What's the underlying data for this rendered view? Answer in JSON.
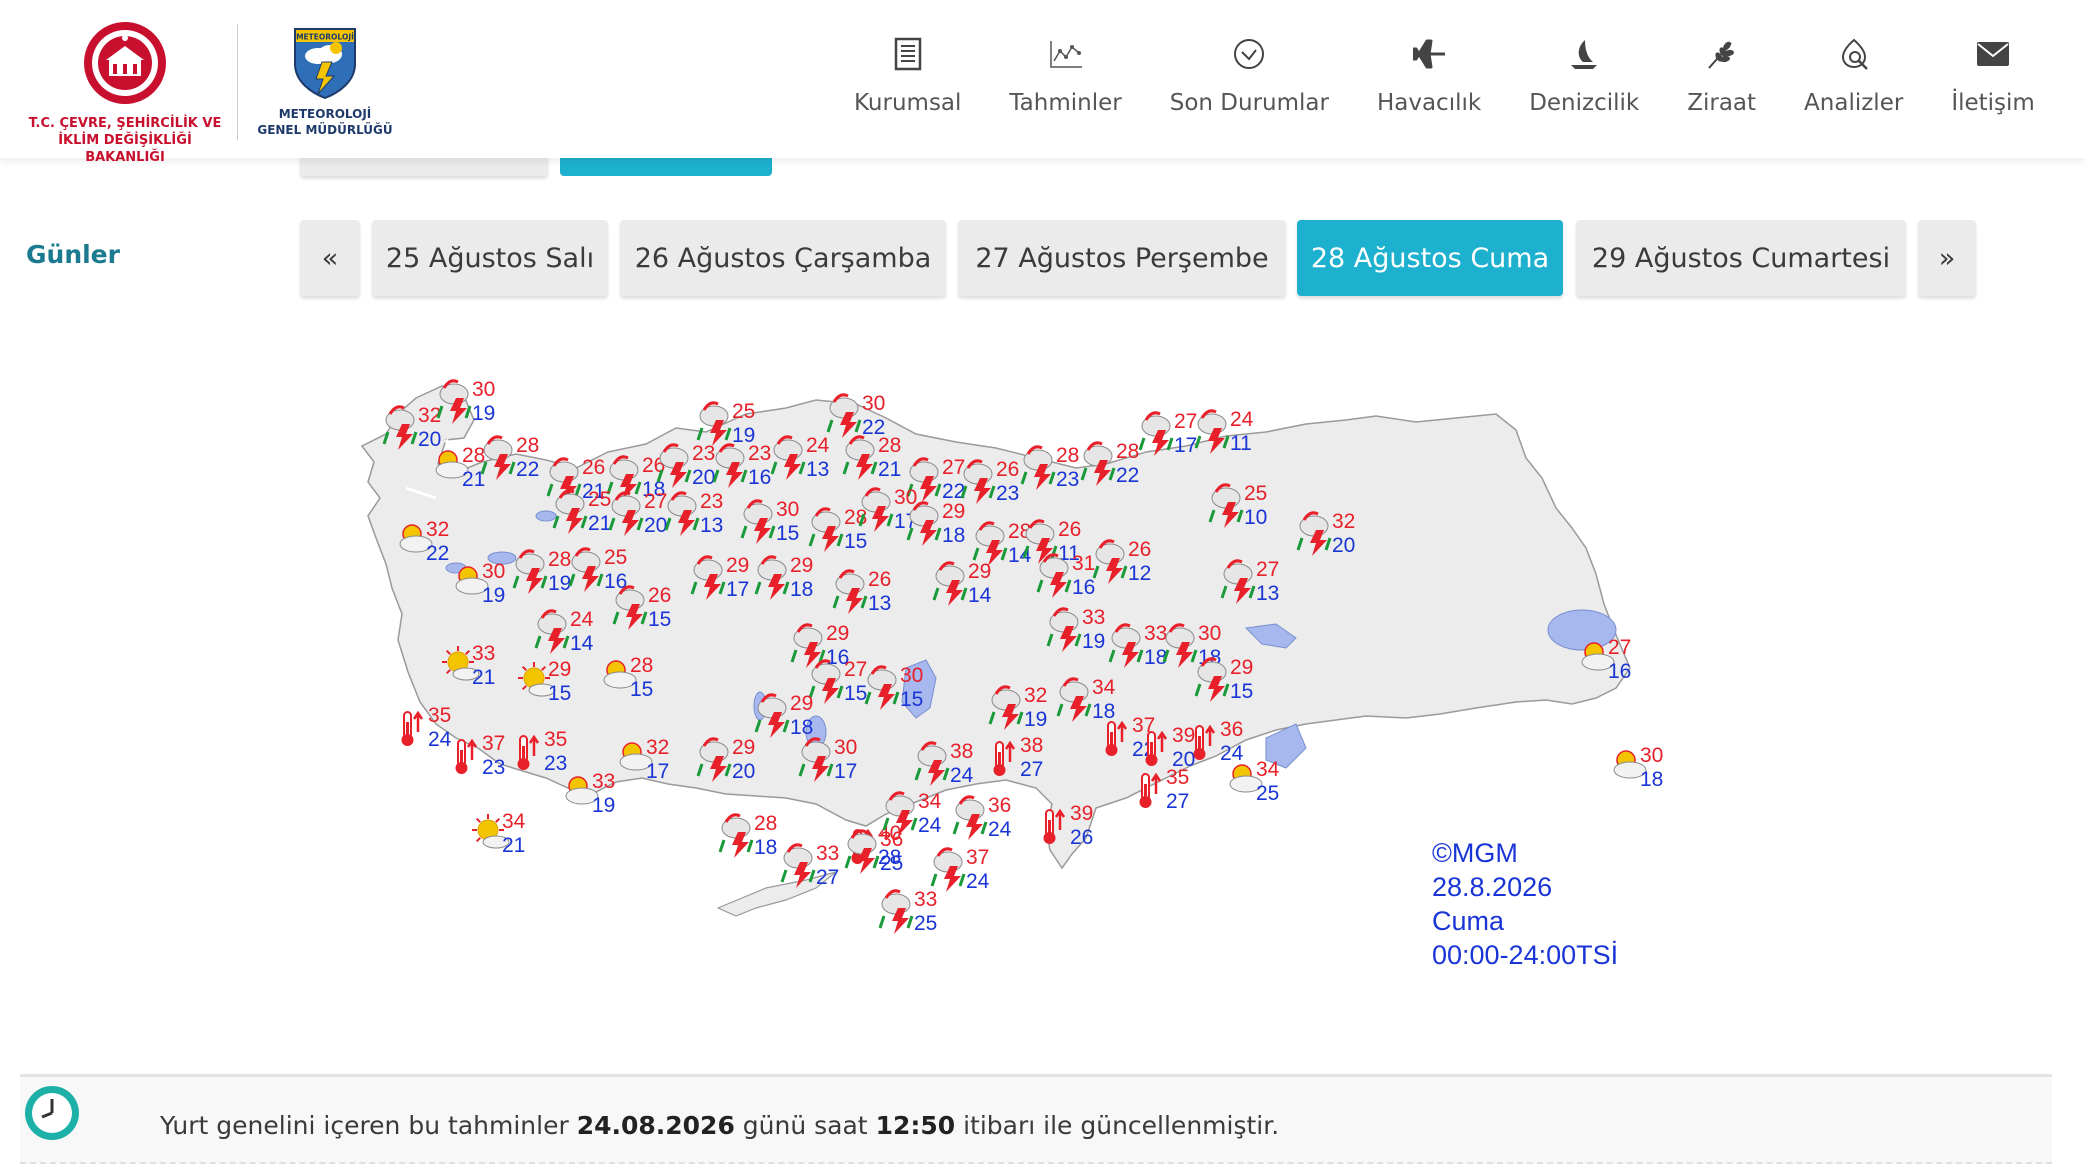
{
  "header": {
    "ministry_logo_text_1": "T.C. ÇEVRE, ŞEHİRCİLİK VE",
    "ministry_logo_text_2": "İKLİM DEĞİŞİKLİĞİ BAKANLIĞI",
    "mgm_logo_top": "METEOROLOJİ",
    "mgm_logo_text_1": "METEOROLOJİ",
    "mgm_logo_text_2": "GENEL MÜDÜRLÜĞÜ",
    "nav": [
      {
        "label": "Kurumsal",
        "icon": "document-icon"
      },
      {
        "label": "Tahminler",
        "icon": "chart-icon"
      },
      {
        "label": "Son Durumlar",
        "icon": "check-circle-icon"
      },
      {
        "label": "Havacılık",
        "icon": "plane-icon"
      },
      {
        "label": "Denizcilik",
        "icon": "sailboat-icon"
      },
      {
        "label": "Ziraat",
        "icon": "wheat-icon"
      },
      {
        "label": "Analizler",
        "icon": "magnifier-icon"
      },
      {
        "label": "İletişim",
        "icon": "envelope-icon"
      }
    ]
  },
  "days": {
    "label": "Günler",
    "prev": "«",
    "next": "»",
    "items": [
      "25 Ağustos Salı",
      "26 Ağustos Çarşamba",
      "27 Ağustos Perşembe",
      "28 Ağustos Cuma",
      "29 Ağustos Cumartesi"
    ],
    "active_index": 3
  },
  "map": {
    "copyright": "©MGM",
    "date": "28.8.2026",
    "day": "Cuma",
    "period": "00:00-24:00TSİ",
    "colors": {
      "max": "#e8202a",
      "min": "#1a35d6",
      "land": "#ececec",
      "water": "#a6b8ee",
      "border": "#8a8a8a"
    },
    "forecasts": [
      {
        "icon": "storm",
        "max": "32",
        "min": "20"
      },
      {
        "icon": "storm",
        "max": "30",
        "min": "19"
      },
      {
        "icon": "partly-sunny",
        "max": "28",
        "min": "21"
      },
      {
        "icon": "storm",
        "max": "28",
        "min": "22"
      },
      {
        "icon": "storm",
        "max": "26",
        "min": "21"
      },
      {
        "icon": "storm",
        "max": "26",
        "min": "18"
      },
      {
        "icon": "storm",
        "max": "23",
        "min": "20"
      },
      {
        "icon": "storm",
        "max": "25",
        "min": "19"
      },
      {
        "icon": "storm",
        "max": "23",
        "min": "16"
      },
      {
        "icon": "storm",
        "max": "24",
        "min": "13"
      },
      {
        "icon": "storm",
        "max": "30",
        "min": "22"
      },
      {
        "icon": "storm",
        "max": "28",
        "min": "21"
      },
      {
        "icon": "storm",
        "max": "27",
        "min": "22"
      },
      {
        "icon": "storm",
        "max": "26",
        "min": "23"
      },
      {
        "icon": "storm",
        "max": "28",
        "min": "23"
      },
      {
        "icon": "storm",
        "max": "28",
        "min": "22"
      },
      {
        "icon": "storm",
        "max": "27",
        "min": "17"
      },
      {
        "icon": "storm",
        "max": "24",
        "min": "11"
      },
      {
        "icon": "partly-sunny",
        "max": "32",
        "min": "22"
      },
      {
        "icon": "storm",
        "max": "25",
        "min": "21"
      },
      {
        "icon": "storm",
        "max": "27",
        "min": "20"
      },
      {
        "icon": "storm",
        "max": "23",
        "min": "13"
      },
      {
        "icon": "storm",
        "max": "30",
        "min": "15"
      },
      {
        "icon": "storm",
        "max": "28",
        "min": "15"
      },
      {
        "icon": "storm",
        "max": "30",
        "min": "17"
      },
      {
        "icon": "storm",
        "max": "29",
        "min": "18"
      },
      {
        "icon": "storm",
        "max": "28",
        "min": "14"
      },
      {
        "icon": "storm",
        "max": "26",
        "min": "11"
      },
      {
        "icon": "storm",
        "max": "26",
        "min": "12"
      },
      {
        "icon": "storm",
        "max": "25",
        "min": "10"
      },
      {
        "icon": "storm",
        "max": "32",
        "min": "20"
      },
      {
        "icon": "partly-sunny",
        "max": "30",
        "min": "19"
      },
      {
        "icon": "storm",
        "max": "28",
        "min": "19"
      },
      {
        "icon": "storm",
        "max": "25",
        "min": "16"
      },
      {
        "icon": "storm",
        "max": "29",
        "min": "17"
      },
      {
        "icon": "storm",
        "max": "29",
        "min": "18"
      },
      {
        "icon": "storm",
        "max": "26",
        "min": "13"
      },
      {
        "icon": "storm",
        "max": "29",
        "min": "14"
      },
      {
        "icon": "storm",
        "max": "31",
        "min": "16"
      },
      {
        "icon": "storm",
        "max": "27",
        "min": "13"
      },
      {
        "icon": "storm",
        "max": "24",
        "min": "14"
      },
      {
        "icon": "storm",
        "max": "26",
        "min": "15"
      },
      {
        "icon": "storm",
        "max": "29",
        "min": "16"
      },
      {
        "icon": "storm",
        "max": "33",
        "min": "19"
      },
      {
        "icon": "storm",
        "max": "33",
        "min": "18"
      },
      {
        "icon": "storm",
        "max": "30",
        "min": "18"
      },
      {
        "icon": "partly-sunny",
        "max": "27",
        "min": "16"
      },
      {
        "icon": "sunny",
        "max": "33",
        "min": "21"
      },
      {
        "icon": "sunny",
        "max": "29",
        "min": "15"
      },
      {
        "icon": "partly-sunny",
        "max": "28",
        "min": "15"
      },
      {
        "icon": "storm",
        "max": "27",
        "min": "15"
      },
      {
        "icon": "storm",
        "max": "30",
        "min": "15"
      },
      {
        "icon": "storm",
        "max": "29",
        "min": "15"
      },
      {
        "icon": "hot",
        "max": "35",
        "min": "24"
      },
      {
        "icon": "storm",
        "max": "29",
        "min": "18"
      },
      {
        "icon": "storm",
        "max": "32",
        "min": "19"
      },
      {
        "icon": "storm",
        "max": "34",
        "min": "18"
      },
      {
        "icon": "hot",
        "max": "37",
        "min": "22"
      },
      {
        "icon": "hot",
        "max": "39",
        "min": "20"
      },
      {
        "icon": "hot",
        "max": "36",
        "min": "24"
      },
      {
        "icon": "hot",
        "max": "37",
        "min": "23"
      },
      {
        "icon": "hot",
        "max": "35",
        "min": "23"
      },
      {
        "icon": "partly-sunny",
        "max": "32",
        "min": "17"
      },
      {
        "icon": "storm",
        "max": "29",
        "min": "20"
      },
      {
        "icon": "storm",
        "max": "30",
        "min": "17"
      },
      {
        "icon": "storm",
        "max": "38",
        "min": "24"
      },
      {
        "icon": "hot",
        "max": "38",
        "min": "27"
      },
      {
        "icon": "partly-sunny",
        "max": "34",
        "min": "25"
      },
      {
        "icon": "partly-sunny",
        "max": "30",
        "min": "18"
      },
      {
        "icon": "partly-sunny",
        "max": "33",
        "min": "19"
      },
      {
        "icon": "hot",
        "max": "35",
        "min": "27"
      },
      {
        "icon": "sunny",
        "max": "34",
        "min": "21"
      },
      {
        "icon": "hot",
        "max": "40",
        "min": "28"
      },
      {
        "icon": "storm",
        "max": "28",
        "min": "18"
      },
      {
        "icon": "storm",
        "max": "34",
        "min": "24"
      },
      {
        "icon": "storm",
        "max": "36",
        "min": "24"
      },
      {
        "icon": "hot",
        "max": "39",
        "min": "26"
      },
      {
        "icon": "storm",
        "max": "33",
        "min": "27"
      },
      {
        "icon": "storm",
        "max": "36",
        "min": "25"
      },
      {
        "icon": "storm",
        "max": "37",
        "min": "24"
      },
      {
        "icon": "storm",
        "max": "33",
        "min": "25"
      }
    ]
  },
  "notice": {
    "prefix": "Yurt genelini içeren bu tahminler ",
    "date": "24.08.2026",
    "middle": " günü saat ",
    "time": "12:50",
    "suffix": " itibarı ile güncellenmiştir."
  }
}
